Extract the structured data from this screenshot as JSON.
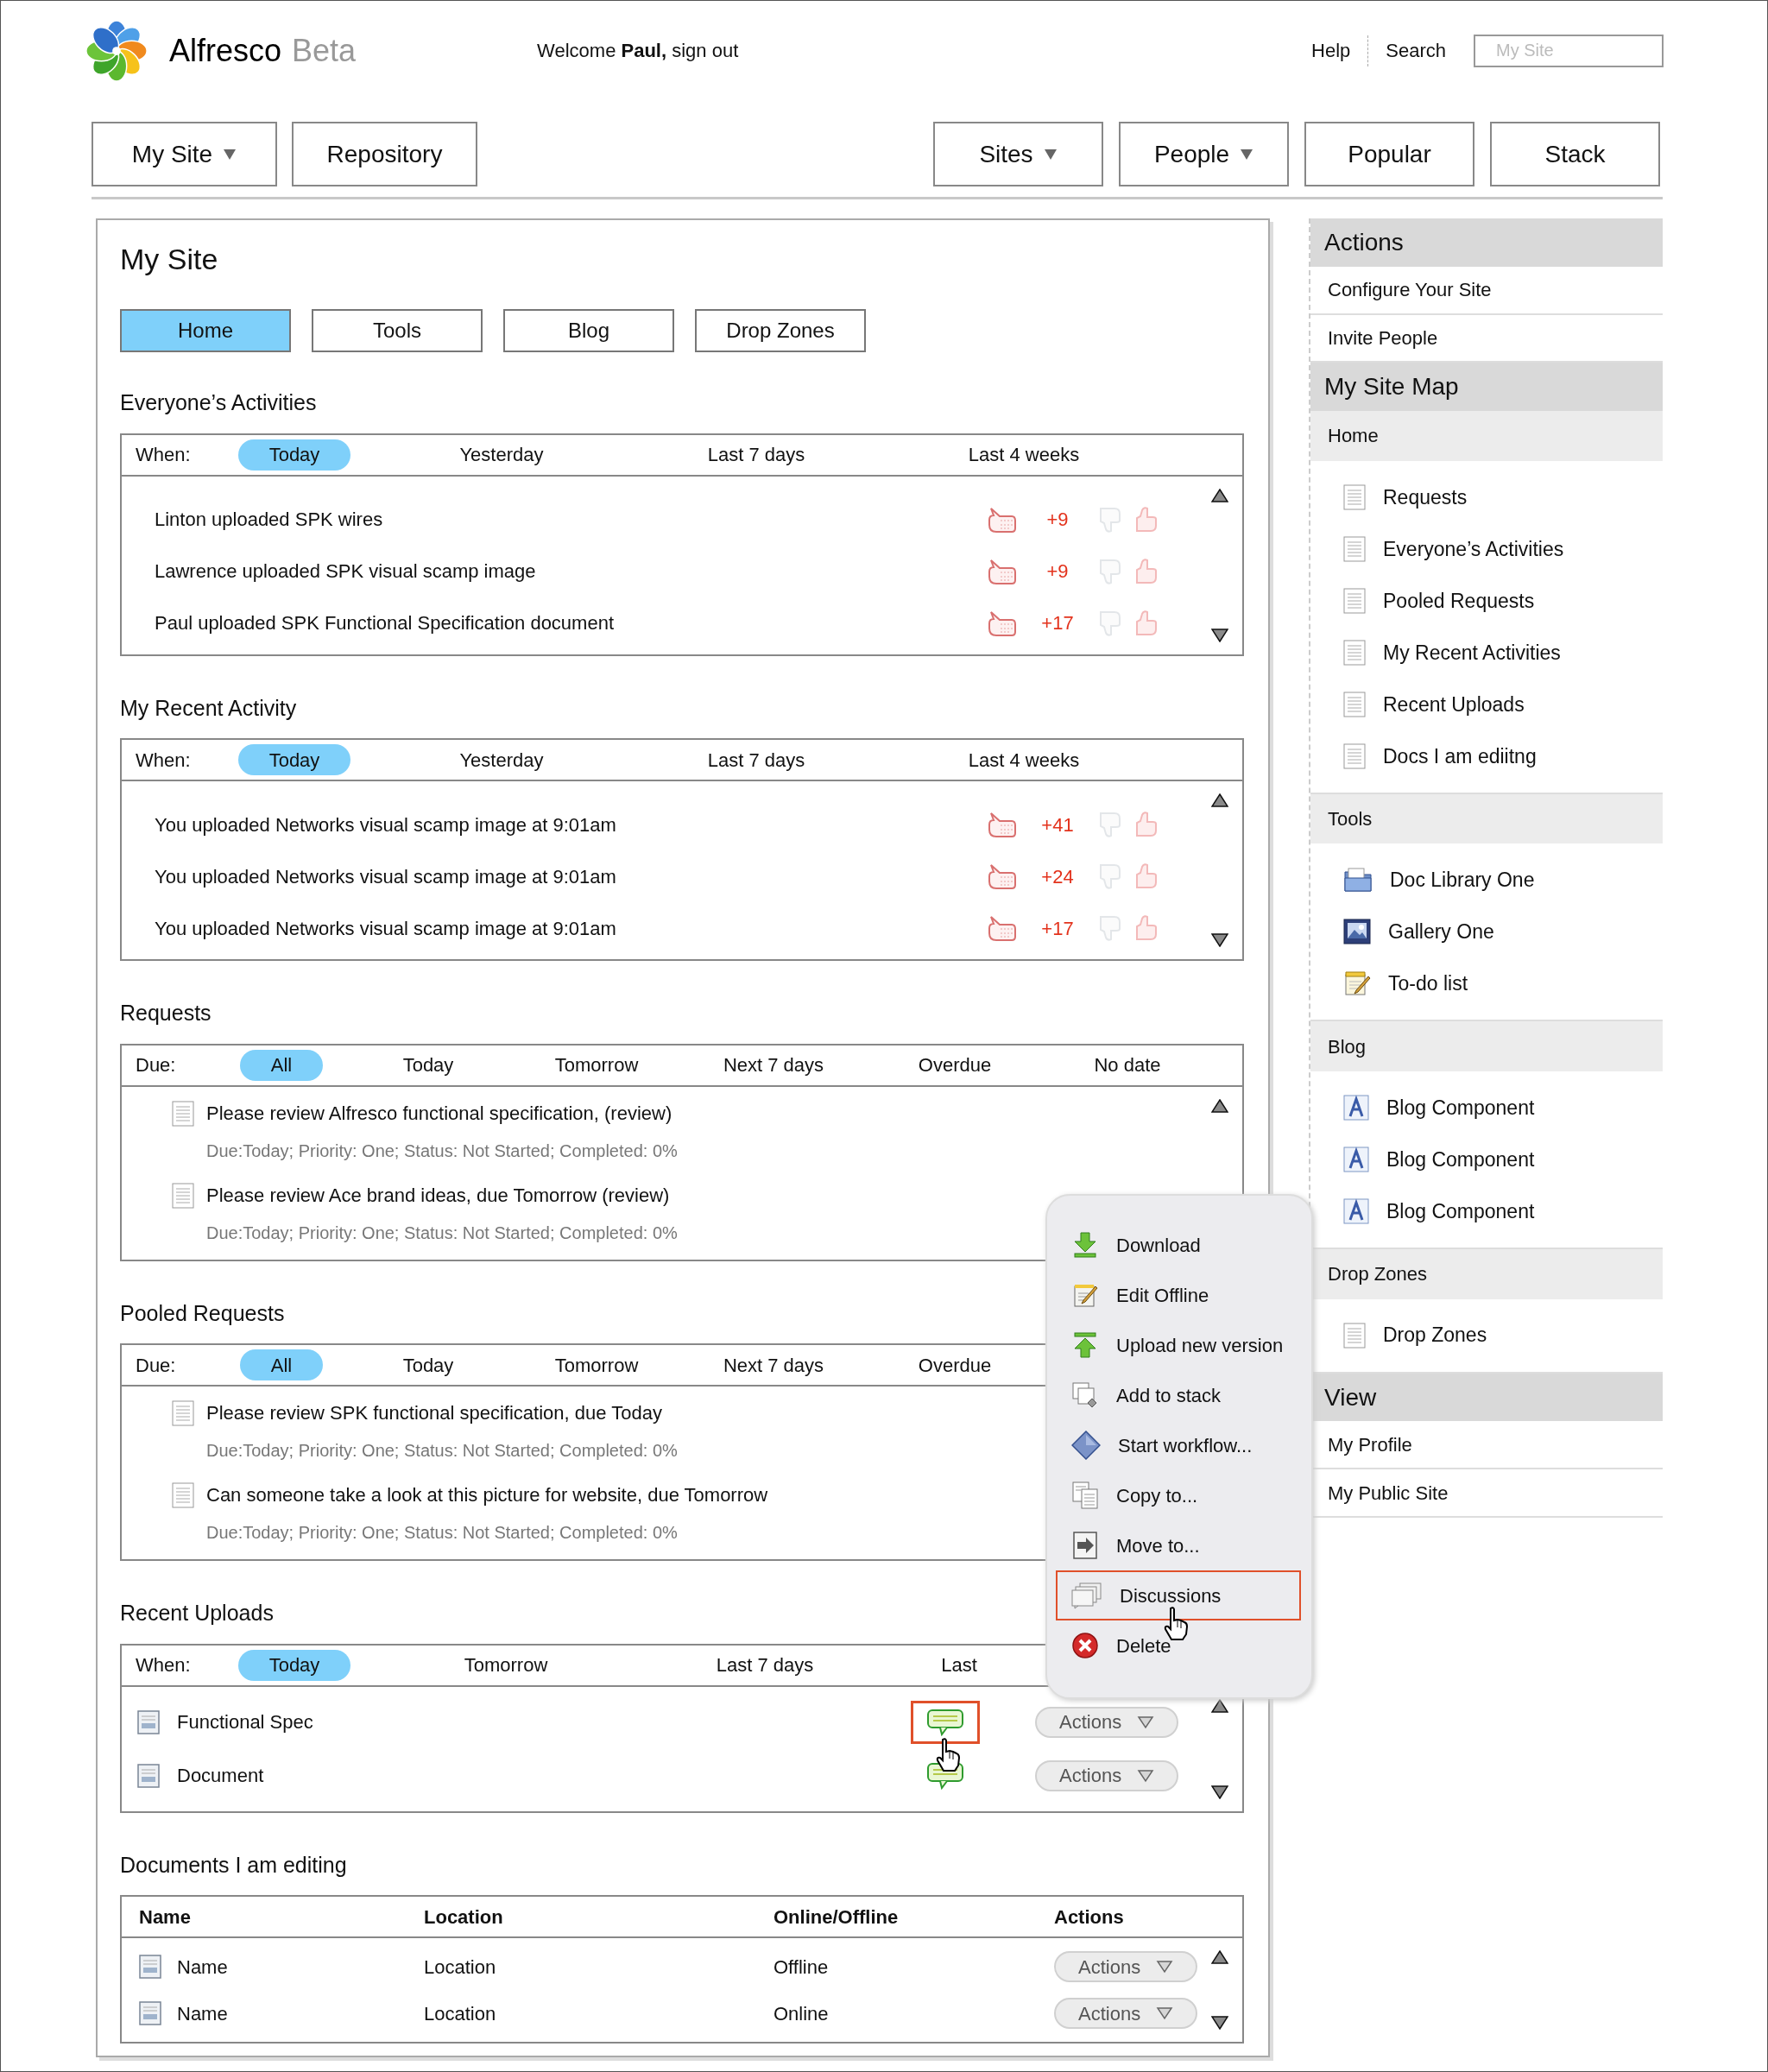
{
  "header": {
    "logo_name": "Alfresco",
    "logo_suffix": "Beta",
    "welcome": "Welcome **Paul,** sign out",
    "links": [
      "Help",
      "Search"
    ],
    "search": {
      "placeholder": "My Site"
    }
  },
  "nav": {
    "left": [
      {
        "label": "My Site",
        "dropdown": true
      },
      {
        "label": "Repository",
        "dropdown": false
      }
    ],
    "right": [
      {
        "label": "Sites",
        "dropdown": true
      },
      {
        "label": "People",
        "dropdown": true
      },
      {
        "label": "Popular",
        "dropdown": false
      },
      {
        "label": "Stack",
        "dropdown": false
      }
    ]
  },
  "main": {
    "title": "My Site",
    "tabs": [
      {
        "label": "Home",
        "selected": true
      },
      {
        "label": "Tools",
        "selected": false
      },
      {
        "label": "Blog",
        "selected": false
      },
      {
        "label": "Drop Zones",
        "selected": false
      }
    ],
    "sections": [
      {
        "kind": "activity",
        "title": "Everyone’s Activities",
        "filter_label": "When:",
        "filters": [
          {
            "label": "Today",
            "selected": true
          },
          {
            "label": "Yesterday",
            "selected": false
          },
          {
            "label": "Last 7 days",
            "selected": false
          },
          {
            "label": "Last 4 weeks",
            "selected": false
          }
        ],
        "items": [
          {
            "text": "Linton uploaded SPK wires",
            "votes": "+9"
          },
          {
            "text": "Lawrence uploaded SPK visual scamp image",
            "votes": "+9"
          },
          {
            "text": "Paul uploaded SPK Functional Specification document",
            "votes": "+17"
          }
        ]
      },
      {
        "kind": "activity",
        "title": "My Recent Activity",
        "filter_label": "When:",
        "filters": [
          {
            "label": "Today",
            "selected": true
          },
          {
            "label": "Yesterday",
            "selected": false
          },
          {
            "label": "Last 7 days",
            "selected": false
          },
          {
            "label": "Last 4 weeks",
            "selected": false
          }
        ],
        "items": [
          {
            "text": "You uploaded Networks visual scamp image at 9:01am",
            "votes": "+41"
          },
          {
            "text": "You uploaded Networks visual scamp image at 9:01am",
            "votes": "+24"
          },
          {
            "text": "You uploaded Networks visual scamp image at 9:01am",
            "votes": "+17"
          }
        ]
      },
      {
        "kind": "requests",
        "title": "Requests",
        "filter_label": "Due:",
        "filters": [
          {
            "label": "All",
            "selected": true
          },
          {
            "label": "Today",
            "selected": false
          },
          {
            "label": "Tomorrow",
            "selected": false
          },
          {
            "label": "Next 7 days",
            "selected": false
          },
          {
            "label": "Overdue",
            "selected": false
          },
          {
            "label": "No date",
            "selected": false
          }
        ],
        "items": [
          {
            "text": "Please review Alfresco functional specification,  (review)",
            "details": "Due:Today; Priority: One; Status: Not Started; Completed: 0%"
          },
          {
            "text": "Please review Ace brand ideas, due Tomorrow (review)",
            "details": "Due:Today; Priority: One; Status: Not Started; Completed: 0%"
          }
        ]
      },
      {
        "kind": "requests",
        "title": "Pooled Requests",
        "filter_label": "Due:",
        "filters": [
          {
            "label": "All",
            "selected": true
          },
          {
            "label": "Today",
            "selected": false
          },
          {
            "label": "Tomorrow",
            "selected": false
          },
          {
            "label": "Next 7 days",
            "selected": false
          },
          {
            "label": "Overdue",
            "selected": false
          }
        ],
        "items": [
          {
            "text": "Please review SPK functional specification, due Today",
            "details": "Due:Today; Priority: One; Status: Not Started; Completed: 0%"
          },
          {
            "text": "Can someone take a look at this picture for website, due Tomorrow",
            "details": "Due:Today; Priority: One; Status: Not Started; Completed: 0%"
          }
        ]
      },
      {
        "kind": "uploads",
        "title": "Recent Uploads",
        "filter_label": "When:",
        "filters": [
          {
            "label": "Today",
            "selected": true
          },
          {
            "label": "Tomorrow",
            "selected": false
          },
          {
            "label": "Last 7 days",
            "selected": false
          },
          {
            "label": "Last",
            "selected": false
          }
        ],
        "items": [
          {
            "name": "Functional Spec",
            "action": "Actions",
            "selected": true
          },
          {
            "name": "Document",
            "action": "Actions",
            "selected": false
          }
        ]
      },
      {
        "kind": "table",
        "title": "Documents I am editing",
        "columns": [
          "Name",
          "Location",
          "Online/Offline",
          "Actions"
        ],
        "rows": [
          {
            "cells": [
              "Name",
              "Location",
              "Offline"
            ],
            "action": "Actions"
          },
          {
            "cells": [
              "Name",
              "Location",
              "Online"
            ],
            "action": "Actions"
          }
        ]
      }
    ]
  },
  "context_menu": {
    "items": [
      {
        "kind": "download",
        "label": "Download",
        "selected": false
      },
      {
        "kind": "edit",
        "label": "Edit Offline",
        "selected": false
      },
      {
        "kind": "upload",
        "label": "Upload new version",
        "selected": false
      },
      {
        "kind": "stack",
        "label": "Add to stack",
        "selected": false
      },
      {
        "kind": "workflow",
        "label": "Start workflow...",
        "selected": false
      },
      {
        "kind": "copy",
        "label": "Copy to...",
        "selected": false
      },
      {
        "kind": "move",
        "label": "Move to...",
        "selected": false
      },
      {
        "kind": "discussions",
        "label": "Discussions",
        "selected": true
      },
      {
        "kind": "delete",
        "label": "Delete",
        "selected": false
      }
    ]
  },
  "sidebar": {
    "blocks": [
      {
        "kind": "heading",
        "title": "Actions"
      },
      {
        "kind": "links",
        "items": [
          {
            "label": "Configure Your Site"
          },
          {
            "label": "Invite People"
          }
        ]
      },
      {
        "kind": "heading",
        "title": "My Site Map"
      },
      {
        "kind": "subheading",
        "title": "Home"
      },
      {
        "kind": "icon_links",
        "items": [
          {
            "kind": "page",
            "label": "Requests"
          },
          {
            "kind": "page",
            "label": "Everyone’s Activities"
          },
          {
            "kind": "page",
            "label": "Pooled Requests"
          },
          {
            "kind": "page",
            "label": "My Recent Activities"
          },
          {
            "kind": "page",
            "label": "Recent Uploads"
          },
          {
            "kind": "page",
            "label": "Docs I am ediitng"
          }
        ]
      },
      {
        "kind": "subheading",
        "title": "Tools"
      },
      {
        "kind": "icon_links",
        "items": [
          {
            "kind": "library",
            "label": "Doc Library One"
          },
          {
            "kind": "gallery",
            "label": "Gallery One"
          },
          {
            "kind": "todo",
            "label": "To-do list"
          }
        ]
      },
      {
        "kind": "subheading",
        "title": "Blog"
      },
      {
        "kind": "icon_links",
        "items": [
          {
            "kind": "blog",
            "label": "Blog Component"
          },
          {
            "kind": "blog",
            "label": "Blog Component"
          },
          {
            "kind": "blog",
            "label": "Blog Component"
          }
        ]
      },
      {
        "kind": "subheading",
        "title": "Drop Zones"
      },
      {
        "kind": "icon_links",
        "items": [
          {
            "kind": "page",
            "label": "Drop Zones"
          }
        ]
      },
      {
        "kind": "heading",
        "title": "View"
      },
      {
        "kind": "links",
        "items": [
          {
            "label": "My Profile"
          },
          {
            "label": "My Public Site"
          }
        ]
      }
    ]
  }
}
